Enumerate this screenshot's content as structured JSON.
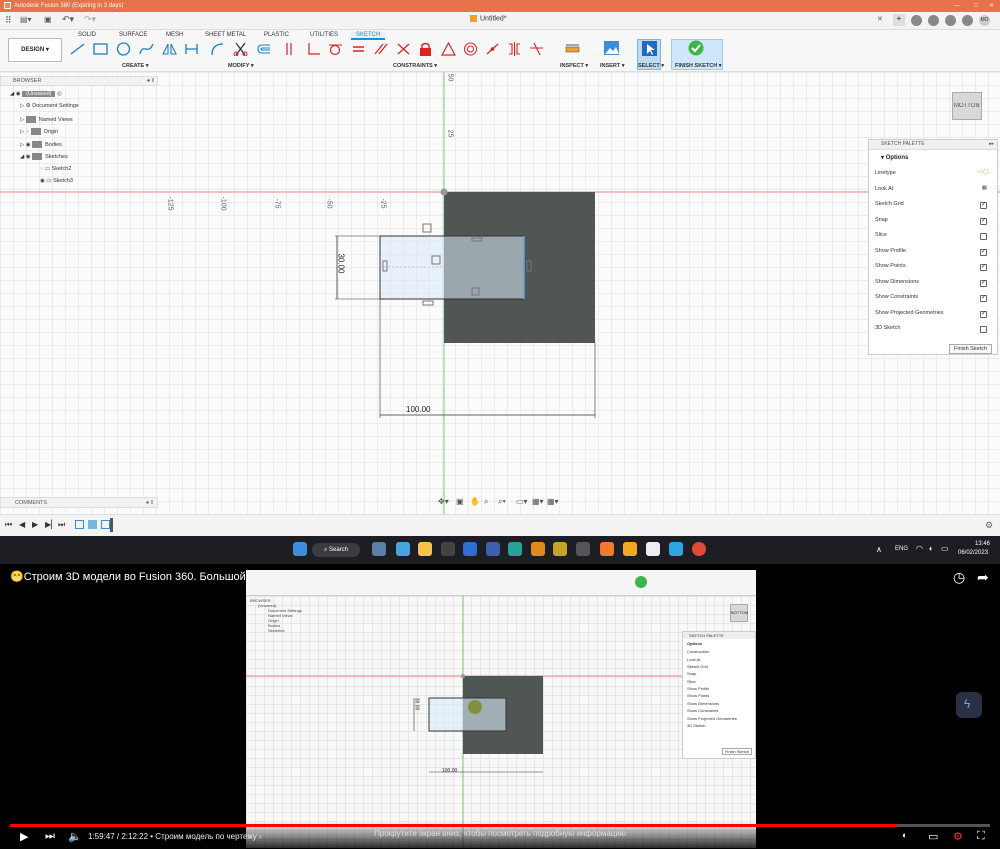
{
  "titlebar": {
    "title": "Autodesk Fusion 360 (Expiring in 3 days)"
  },
  "appbar": {
    "document": "Untitled*",
    "user": "MO"
  },
  "tabs": [
    "SOLID",
    "SURFACE",
    "MESH",
    "SHEET METAL",
    "PLASTIC",
    "UTILITIES",
    "SKETCH"
  ],
  "toolbar": {
    "design": "DESIGN ▾",
    "groups": [
      "CREATE ▾",
      "MODIFY ▾",
      "CONSTRAINTS ▾",
      "INSPECT ▾",
      "INSERT ▾",
      "SELECT ▾",
      "FINISH SKETCH ▾"
    ]
  },
  "browser": {
    "title": "BROWSER",
    "root": "(Unsaved)",
    "items": [
      "Document Settings",
      "Named Views",
      "Origin",
      "Bodies",
      "Sketches",
      "Sketch2",
      "Sketch3"
    ]
  },
  "comments": "COMMENTS",
  "rulers": {
    "vertical": [
      "50",
      "25"
    ],
    "horizontal": [
      "-125",
      "-100",
      "-75",
      "-50",
      "-25"
    ]
  },
  "dimensions": {
    "height": "30.00",
    "width": "100.00"
  },
  "viewcube": "BOTTOM",
  "palette": {
    "title": "SKETCH PALETTE",
    "options_label": "Options",
    "rows": [
      {
        "label": "Linetype",
        "checked": null
      },
      {
        "label": "Look At",
        "checked": null
      },
      {
        "label": "Sketch Grid",
        "checked": true
      },
      {
        "label": "Snap",
        "checked": true
      },
      {
        "label": "Slice",
        "checked": false
      },
      {
        "label": "Show Profile",
        "checked": true
      },
      {
        "label": "Show Points",
        "checked": true
      },
      {
        "label": "Show Dimensions",
        "checked": true
      },
      {
        "label": "Show Constraints",
        "checked": true
      },
      {
        "label": "Show Projected Geometries",
        "checked": true
      },
      {
        "label": "3D Sketch",
        "checked": false
      }
    ],
    "finish": "Finish Sketch"
  },
  "taskbar": {
    "search": "Search",
    "lang": "ENG",
    "time": "13:46",
    "date": "06/02/2023"
  },
  "youtube": {
    "title": "😁Строим 3D модели во Fusion 360. Большой гайд",
    "time": "1:59:47 / 2:12:22 • Строим модель по чертежу ›",
    "hint": "Прокрутите экран вниз, чтобы посмотреть подробную информацию",
    "progress": 0.905
  },
  "video_inner": {
    "height_dim": "30.00",
    "width_dim": "100.00",
    "palette_title": "SKETCH PALETTE",
    "options": "Options",
    "rows": [
      "Construction",
      "Look At",
      "Sketch Grid",
      "Snap",
      "Slice",
      "Show Profile",
      "Show Points",
      "Show Dimensions",
      "Show Constraints",
      "Show Projected Geometries",
      "3D Sketch"
    ],
    "finish": "Finish Sketch",
    "viewcube": "BOTTOM",
    "browser": "BROWSER",
    "browser_items": [
      "(Unsaved)",
      "Document Settings",
      "Named Views",
      "Origin",
      "Bodies",
      "Sketches"
    ]
  }
}
